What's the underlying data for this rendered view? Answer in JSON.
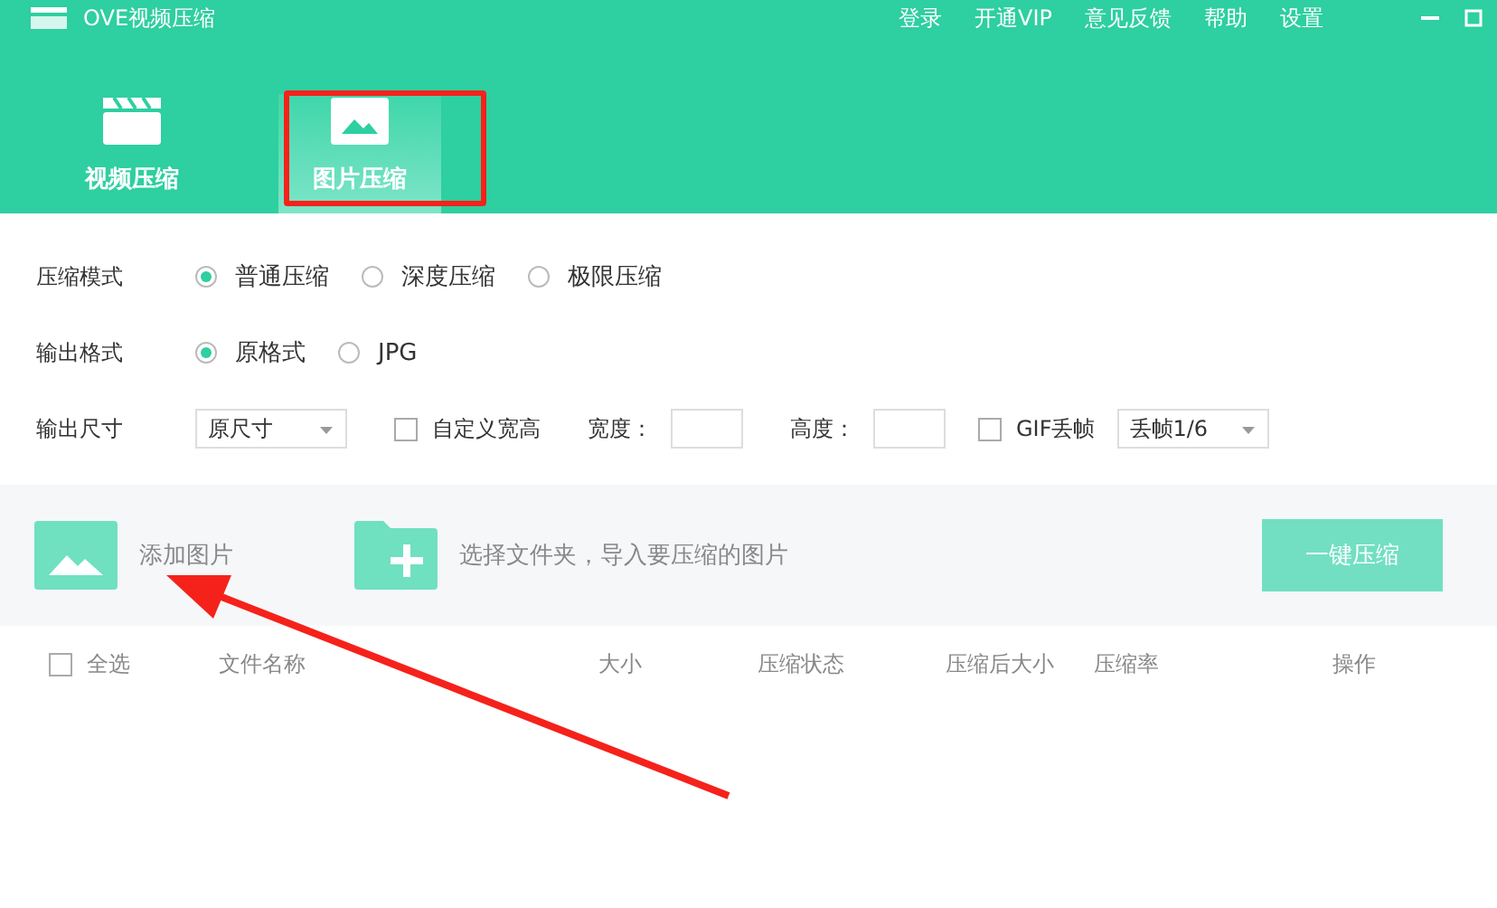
{
  "window": {
    "title": "OVE视频压缩",
    "menu": [
      "登录",
      "开通VIP",
      "意见反馈",
      "帮助",
      "设置"
    ]
  },
  "tabs": [
    {
      "label": "视频压缩",
      "kind": "video",
      "selected": false
    },
    {
      "label": "图片压缩",
      "kind": "image",
      "selected": true
    }
  ],
  "settings": {
    "mode": {
      "label": "压缩模式",
      "options": [
        {
          "label": "普通压缩",
          "selected": true
        },
        {
          "label": "深度压缩",
          "selected": false
        },
        {
          "label": "极限压缩",
          "selected": false
        }
      ]
    },
    "format": {
      "label": "输出格式",
      "options": [
        {
          "label": "原格式",
          "selected": true
        },
        {
          "label": "JPG",
          "selected": false
        }
      ]
    },
    "size": {
      "label": "输出尺寸",
      "dropdown": "原尺寸",
      "custom": {
        "label": "自定义宽高",
        "checked": false
      },
      "width_label": "宽度：",
      "height_label": "高度：",
      "gif": {
        "label": "GIF丢帧",
        "checked": false
      },
      "gif_dropdown": "丢帧1/6"
    }
  },
  "toolbar": {
    "add_image": "添加图片",
    "add_folder": "选择文件夹，导入要压缩的图片",
    "compress_button": "一键压缩"
  },
  "table": {
    "select_all": {
      "label": "全选",
      "checked": false
    },
    "columns": [
      "文件名称",
      "大小",
      "压缩状态",
      "压缩后大小",
      "压缩率",
      "操作"
    ]
  }
}
